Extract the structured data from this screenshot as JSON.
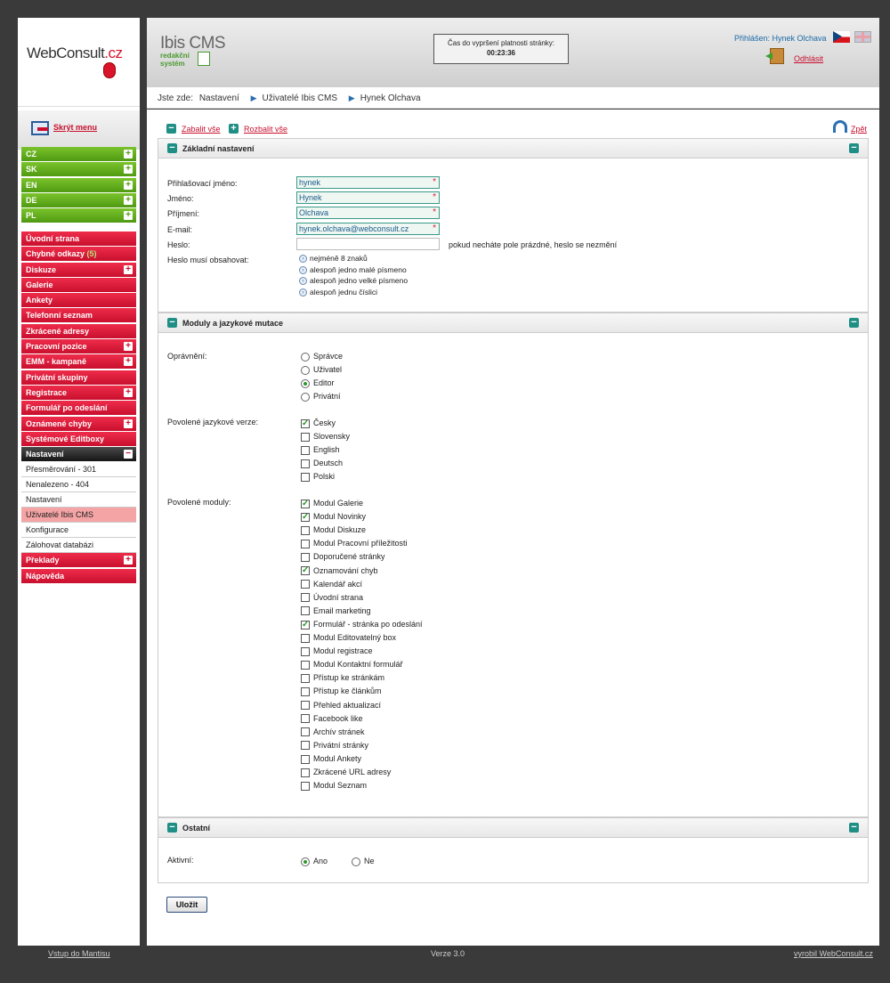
{
  "logo": {
    "brand": "WebConsult",
    "tld": ".cz"
  },
  "sidebar": {
    "hide_menu": "Skrýt menu",
    "languages": [
      "CZ",
      "SK",
      "EN",
      "DE",
      "PL"
    ],
    "menu": [
      {
        "label": "Úvodní strana",
        "plus": false
      },
      {
        "label": "Chybné odkazy",
        "count": "(5)",
        "plus": false
      },
      {
        "label": "Diskuze",
        "plus": true
      },
      {
        "label": "Galerie",
        "plus": false
      },
      {
        "label": "Ankety",
        "plus": false
      },
      {
        "label": "Telefonní seznam",
        "plus": false
      },
      {
        "label": "Zkrácené adresy",
        "plus": false
      },
      {
        "label": "Pracovní pozice",
        "plus": true
      },
      {
        "label": "EMM - kampaně",
        "plus": true
      },
      {
        "label": "Privátní skupiny",
        "plus": false
      },
      {
        "label": "Registrace",
        "plus": true
      },
      {
        "label": "Formulář po odeslání",
        "plus": false
      },
      {
        "label": "Oznámené chyby",
        "plus": true
      },
      {
        "label": "Systémové Editboxy",
        "plus": false
      }
    ],
    "settings": {
      "label": "Nastavení",
      "sub": [
        "Přesměrování - 301",
        "Nenalezeno - 404",
        "Nastavení",
        "Uživatelé Ibis CMS",
        "Konfigurace",
        "Zálohovat databázi"
      ],
      "active_index": 3
    },
    "after": [
      {
        "label": "Překlady",
        "plus": true
      },
      {
        "label": "Nápověda",
        "plus": false
      }
    ]
  },
  "header": {
    "cms_title": "Ibis CMS",
    "cms_sub1": "redakční",
    "cms_sub2": "systém",
    "timer_label": "Čas do vypršení platnosti stránky:",
    "timer_value": "00:23:36",
    "logged_in": "Přihlášen: Hynek Olchava",
    "logout": "Odhlásit"
  },
  "breadcrumb": {
    "prefix": "Jste zde:",
    "items": [
      "Nastavení",
      "Uživatelé Ibis CMS",
      "Hynek Olchava"
    ]
  },
  "toolbar": {
    "collapse": "Zabalit vše",
    "expand": "Rozbalit vše",
    "back": "Zpět"
  },
  "basic": {
    "title": "Základní nastavení",
    "login_label": "Přihlašovací jméno:",
    "login": "hynek",
    "name_label": "Jméno:",
    "name": "Hynek",
    "surname_label": "Příjmení:",
    "surname": "Olchava",
    "email_label": "E-mail:",
    "email": "hynek.olchava@webconsult.cz",
    "password_label": "Heslo:",
    "password": "",
    "password_note": "pokud necháte pole prázdné, heslo se nezmění",
    "rules_label": "Heslo musí obsahovat:",
    "rules": [
      "nejméně 8 znaků",
      "alespoň jedno malé písmeno",
      "alespoň jedno velké písmeno",
      "alespoň jednu číslici"
    ]
  },
  "modules": {
    "title": "Moduly a jazykové mutace",
    "perm_label": "Oprávnění:",
    "perms": [
      "Správce",
      "Uživatel",
      "Editor",
      "Privátní"
    ],
    "perm_selected": 2,
    "lang_label": "Povolené jazykové verze:",
    "langs": [
      {
        "l": "Česky",
        "c": true
      },
      {
        "l": "Slovensky",
        "c": false
      },
      {
        "l": "English",
        "c": false
      },
      {
        "l": "Deutsch",
        "c": false
      },
      {
        "l": "Polski",
        "c": false
      }
    ],
    "mod_label": "Povolené moduly:",
    "mods": [
      {
        "l": "Modul Galerie",
        "c": true
      },
      {
        "l": "Modul Novinky",
        "c": true
      },
      {
        "l": "Modul Diskuze",
        "c": false
      },
      {
        "l": "Modul Pracovní příležitosti",
        "c": false
      },
      {
        "l": "Doporučené stránky",
        "c": false
      },
      {
        "l": "Oznamování chyb",
        "c": true
      },
      {
        "l": "Kalendář akcí",
        "c": false
      },
      {
        "l": "Úvodní strana",
        "c": false
      },
      {
        "l": "Email marketing",
        "c": false
      },
      {
        "l": "Formulář - stránka po odeslání",
        "c": true
      },
      {
        "l": "Modul Editovatelný box",
        "c": false
      },
      {
        "l": "Modul registrace",
        "c": false
      },
      {
        "l": "Modul Kontaktní formulář",
        "c": false
      },
      {
        "l": "Přístup ke stránkám",
        "c": false
      },
      {
        "l": "Přístup ke článkům",
        "c": false
      },
      {
        "l": "Přehled aktualizací",
        "c": false
      },
      {
        "l": "Facebook like",
        "c": false
      },
      {
        "l": "Archív stránek",
        "c": false
      },
      {
        "l": "Privátní stránky",
        "c": false
      },
      {
        "l": "Modul Ankety",
        "c": false
      },
      {
        "l": "Zkrácené URL adresy",
        "c": false
      },
      {
        "l": "Modul Seznam",
        "c": false
      }
    ]
  },
  "other": {
    "title": "Ostatní",
    "active_label": "Aktivní:",
    "yes": "Ano",
    "no": "Ne",
    "selected": "yes"
  },
  "save": "Uložit",
  "footer": {
    "mantis": "Vstup do Mantisu",
    "version": "Verze 3.0",
    "made_by": "vyrobil WebConsult.cz"
  }
}
